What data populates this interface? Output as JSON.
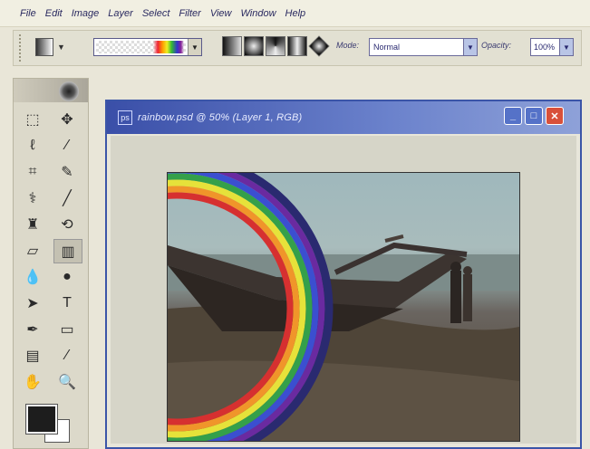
{
  "menu": [
    "File",
    "Edit",
    "Image",
    "Layer",
    "Select",
    "Filter",
    "View",
    "Window",
    "Help"
  ],
  "options": {
    "mode_label": "Mode:",
    "mode_value": "Normal",
    "opacity_label": "Opacity:",
    "opacity_value": "100%"
  },
  "document": {
    "title": "rainbow.psd @ 50% (Layer 1, RGB)"
  },
  "icons": {
    "toolbox": [
      "marquee-icon",
      "move-icon",
      "lasso-icon",
      "magic-wand-icon",
      "crop-icon",
      "slice-icon",
      "healing-brush-icon",
      "brush-icon",
      "clone-stamp-icon",
      "history-brush-icon",
      "eraser-icon",
      "gradient-icon",
      "blur-icon",
      "dodge-icon",
      "path-selection-icon",
      "type-icon",
      "pen-icon",
      "shape-icon",
      "notes-icon",
      "eyedropper-icon",
      "hand-icon",
      "zoom-icon"
    ]
  },
  "colors": {
    "foreground": "#1d1d1d",
    "background": "#ffffff",
    "titlebar": "#3a4fa8"
  }
}
